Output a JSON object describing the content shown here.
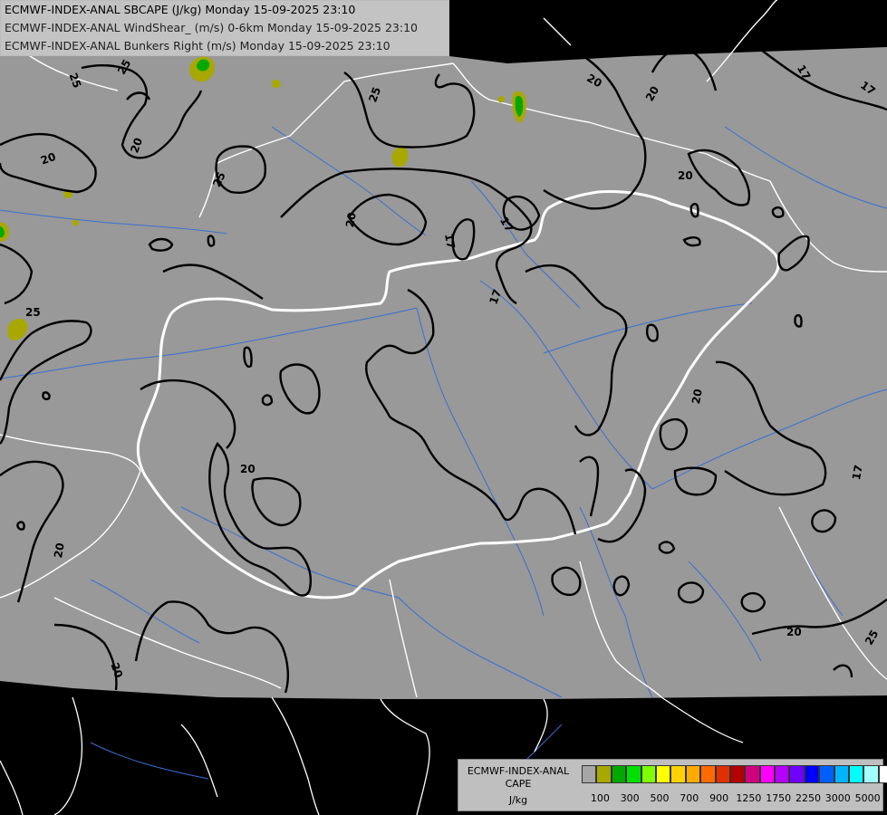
{
  "title_lines": [
    "ECMWF-INDEX-ANAL SBCAPE (J/kg) Monday 15-09-2025 23:10",
    "ECMWF-INDEX-ANAL WindShear_ (m/s) 0-6km Monday 15-09-2025 23:10",
    "ECMWF-INDEX-ANAL Bunkers Right (m/s) Monday 15-09-2025 23:10"
  ],
  "legend": {
    "product": "ECMWF-INDEX-ANAL",
    "parameter": "CAPE",
    "unit": "J/kg",
    "colors": [
      "#a6a6a6",
      "#a8a800",
      "#00a800",
      "#00e000",
      "#7fff00",
      "#ffff00",
      "#ffd200",
      "#ffaa00",
      "#ff6a00",
      "#e03000",
      "#b40000",
      "#d0007f",
      "#ff00ff",
      "#b400ff",
      "#7000ff",
      "#0000ff",
      "#0060ff",
      "#00b4ff",
      "#00ffff",
      "#a0ffff",
      "#ffffff"
    ],
    "tick_labels": [
      "100",
      "300",
      "500",
      "700",
      "900",
      "1250",
      "1750",
      "2250",
      "3000",
      "5000"
    ]
  },
  "contour_labels": [
    "25",
    "25",
    "25",
    "25",
    "20",
    "20",
    "20",
    "20",
    "20",
    "20",
    "20",
    "20",
    "20",
    "20",
    "17",
    "17",
    "17",
    "17",
    "17",
    "25"
  ],
  "colors": {
    "domain_fill": "#999999",
    "outside": "#000000",
    "borders": "#ffffff",
    "rivers": "#3a6fd1",
    "contours": "#000000",
    "cape_low": "#a8a800",
    "cape_mid": "#00a800"
  }
}
